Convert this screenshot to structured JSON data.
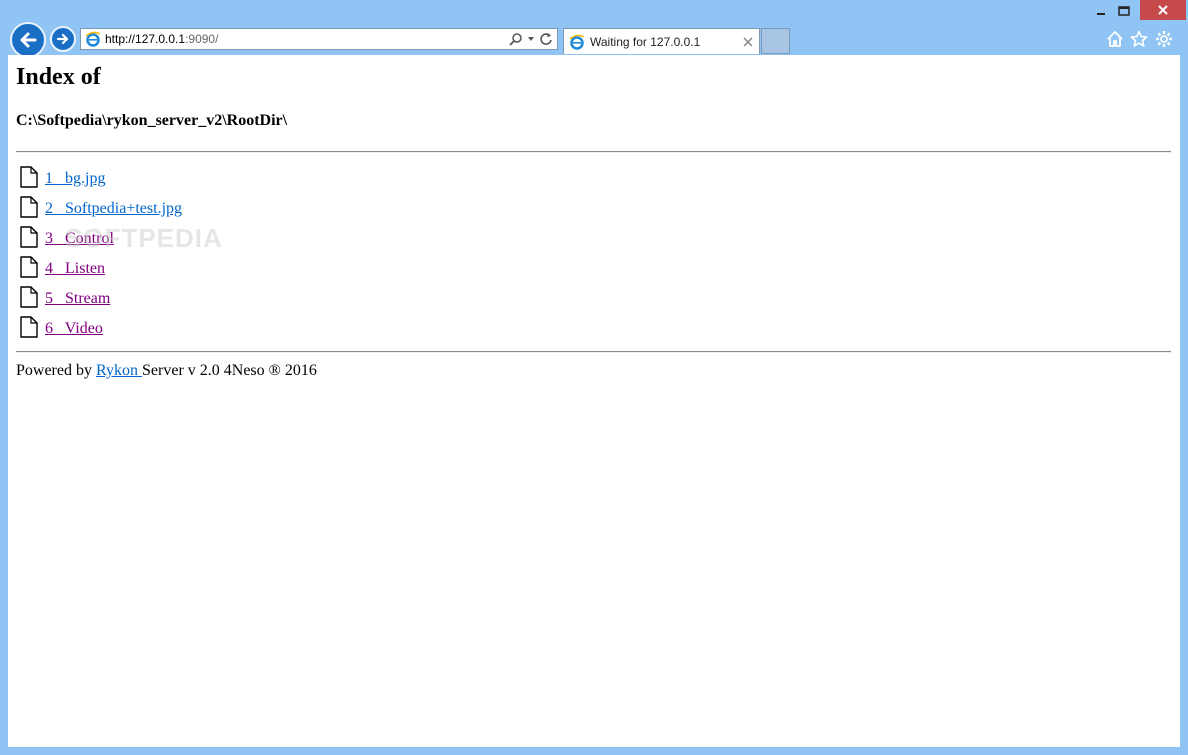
{
  "browser": {
    "address_url_host": "http://127.0.0.1",
    "address_url_rest": ":9090/",
    "tab_title": "Waiting for 127.0.0.1",
    "icons": {
      "back": "back-arrow-icon",
      "forward": "forward-arrow-icon",
      "search": "search-icon",
      "refresh": "refresh-icon",
      "home": "home-icon",
      "favorites": "star-icon",
      "tools": "gear-icon"
    }
  },
  "page": {
    "heading": "Index of",
    "path": "C:\\Softpedia\\rykon_server_v2\\RootDir\\",
    "files": [
      {
        "label": "1   bg.jpg",
        "visited": false
      },
      {
        "label": "2   Softpedia+test.jpg",
        "visited": false
      },
      {
        "label": "3   Control",
        "visited": true
      },
      {
        "label": "4   Listen",
        "visited": true
      },
      {
        "label": "5   Stream",
        "visited": true
      },
      {
        "label": "6   Video",
        "visited": true
      }
    ],
    "footer_prefix": "Powered by ",
    "footer_link": "Rykon ",
    "footer_suffix": "Server v 2.0 4Neso ® 2016"
  },
  "watermark": "SOFTPEDIA",
  "colors": {
    "link": "#0066cc",
    "visited": "#800080",
    "chrome": "#8fc4f4",
    "close": "#c74a4a"
  }
}
